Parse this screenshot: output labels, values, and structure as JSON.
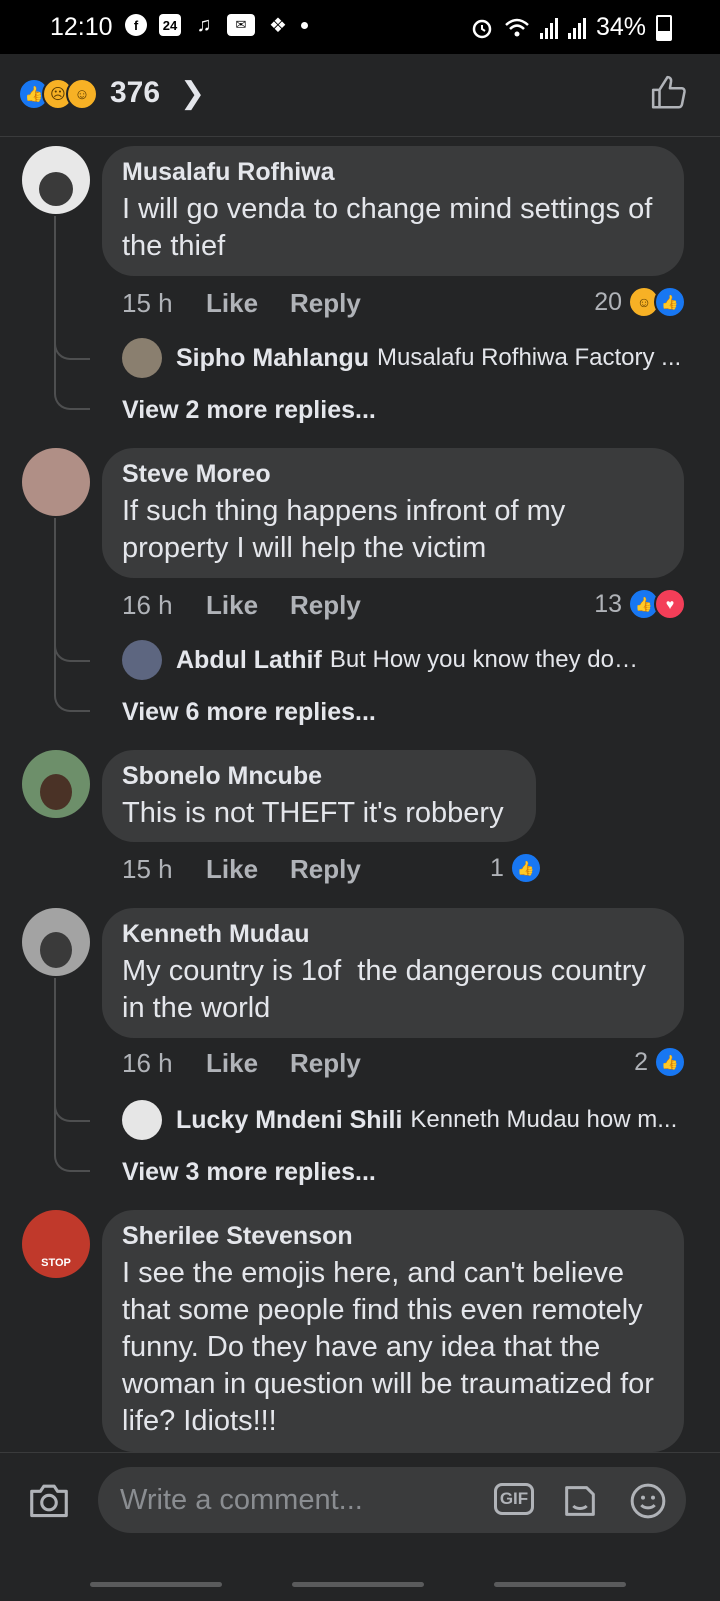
{
  "status_bar": {
    "time": "12:10",
    "battery": "34%",
    "icons": [
      "facebook-icon",
      "calendar-24-icon",
      "notification-icon",
      "email-icon",
      "twitter-icon",
      "alarm-icon",
      "wifi-icon",
      "signal-icon"
    ],
    "calendar_day": "24"
  },
  "reactions_header": {
    "count": "376",
    "types": [
      "like",
      "sad",
      "haha"
    ]
  },
  "comments": [
    {
      "author": "Musalafu Rofhiwa",
      "text": "I will go venda to change mind settings of the thief",
      "time": "15 h",
      "like_label": "Like",
      "reply_label": "Reply",
      "reaction_count": "20",
      "reactions": [
        "haha",
        "like"
      ],
      "avatar_color": "#d9d9d9",
      "reply_preview": {
        "author": "Sipho Mahlangu",
        "text": "Musalafu Rofhiwa Factory ..."
      },
      "more_replies": "View 2 more replies..."
    },
    {
      "author": "Steve Moreo",
      "text": "If such thing happens infront of my property I will help the victim",
      "time": "16 h",
      "like_label": "Like",
      "reply_label": "Reply",
      "reaction_count": "13",
      "reactions": [
        "like",
        "love"
      ],
      "avatar_color": "#b08f86",
      "reply_preview": {
        "author": "Abdul Lathif",
        "text": "But How you know they don't...."
      },
      "more_replies": "View 6 more replies..."
    },
    {
      "author": "Sbonelo Mncube",
      "text": "This is not THEFT it's robbery",
      "time": "15 h",
      "like_label": "Like",
      "reply_label": "Reply",
      "reaction_count": "1",
      "reactions": [
        "like"
      ],
      "avatar_color": "#6d8f6a"
    },
    {
      "author": "Kenneth Mudau",
      "text": "My country is 1of  the dangerous country in the world",
      "time": "16 h",
      "like_label": "Like",
      "reply_label": "Reply",
      "reaction_count": "2",
      "reactions": [
        "like"
      ],
      "avatar_color": "#9a9a9a",
      "reply_preview": {
        "author": "Lucky Mndeni Shili",
        "text": "Kenneth Mudau how m..."
      },
      "more_replies": "View 3 more replies..."
    },
    {
      "author": "Sherilee Stevenson",
      "text": "I see the emojis here, and can't believe that some people find this even remotely funny. Do they have any idea that the woman in question will be traumatized for life? Idiots!!!",
      "avatar_color": "#c0392b",
      "avatar_badge": "STOP"
    }
  ],
  "composer": {
    "placeholder": "Write a comment...",
    "gif_label": "GIF"
  },
  "colors": {
    "background": "#242526",
    "bubble": "#3a3b3c",
    "like_blue": "#1877f2",
    "love_red": "#f33e58",
    "haha_yellow": "#f7b125"
  }
}
